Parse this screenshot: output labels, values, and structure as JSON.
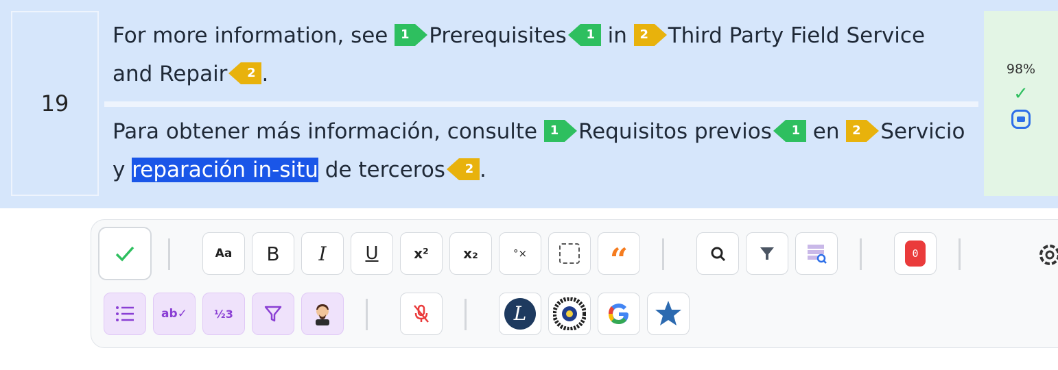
{
  "segment": {
    "number": "19",
    "source": {
      "t1": "For more information, see ",
      "tag1": "1",
      "t2": "Prerequisites",
      "t3": " in ",
      "tag2": "2",
      "t4": "Third Party Field Service and Repair",
      "t5": "."
    },
    "target": {
      "t1": "Para obtener más información, consulte ",
      "tag1": "1",
      "t2": "Requisitos previos",
      "t3": " en ",
      "tag2": "2",
      "t4a": "Servicio y ",
      "highlight": "reparación in-situ",
      "t4b": " de terceros",
      "t5": "."
    },
    "match_percent": "98%",
    "status_icon": "check-icon",
    "comment_icon": "comment-icon"
  },
  "toolbar": {
    "confirm_icon": "check-icon",
    "case_label": "Aa",
    "bold_label": "B",
    "italic_label": "I",
    "underline_label": "U",
    "superscript_label": "x²",
    "subscript_label": "x₂",
    "special_char_label": "°×",
    "error_count": "0",
    "stats_label": "½3"
  },
  "colors": {
    "tag_green": "#2ebf5f",
    "tag_yellow": "#e8b20c",
    "highlight": "#1a56e8",
    "row_background": "#d6e6fb",
    "status_background": "#e3f5e5",
    "error_badge": "#ea3b3b"
  }
}
